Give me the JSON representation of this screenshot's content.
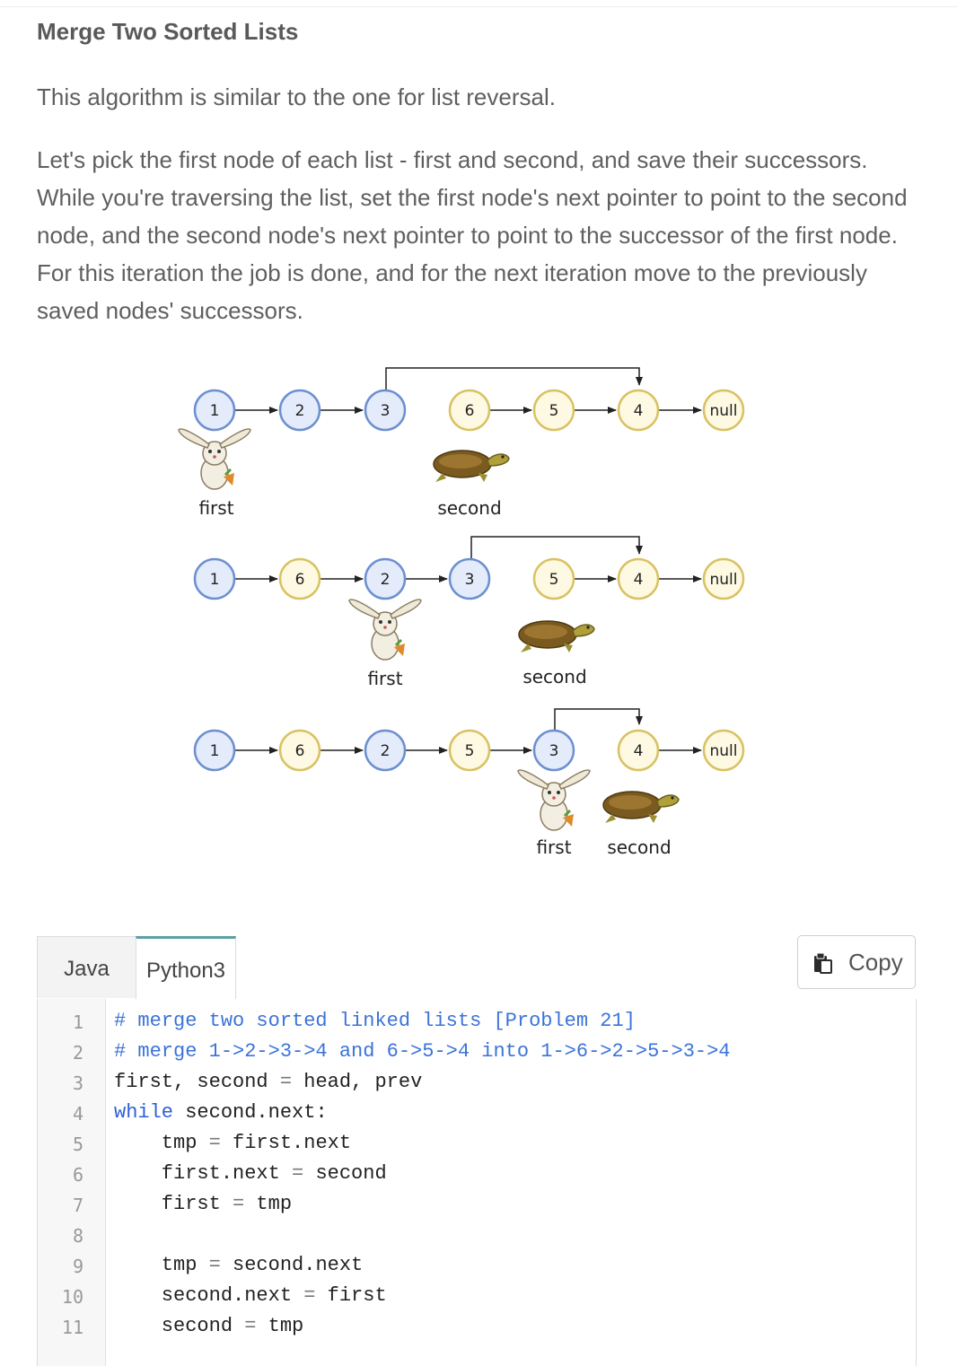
{
  "article": {
    "title": "Merge Two Sorted Lists",
    "paragraph1": "This algorithm is similar to the one for list reversal.",
    "paragraph2": "Let's pick the first node of each list - first and second, and save their successors. While you're traversing the list, set the first node's next pointer to point to the second node, and the second node's next pointer to point to the successor of the first node. For this iteration the job is done, and for the next iteration move to the previously saved nodes' successors."
  },
  "diagram": {
    "rows": [
      {
        "nodes": [
          {
            "text": "1",
            "color": "blue"
          },
          {
            "text": "2",
            "color": "blue"
          },
          {
            "text": "3",
            "color": "blue"
          },
          {
            "text": "6",
            "color": "yellow"
          },
          {
            "text": "5",
            "color": "yellow"
          },
          {
            "text": "4",
            "color": "yellow"
          },
          {
            "text": "null",
            "color": "yellow"
          }
        ],
        "labels": {
          "first": "first",
          "second": "second"
        }
      },
      {
        "nodes": [
          {
            "text": "1",
            "color": "blue"
          },
          {
            "text": "6",
            "color": "yellow"
          },
          {
            "text": "2",
            "color": "blue"
          },
          {
            "text": "3",
            "color": "blue"
          },
          {
            "text": "5",
            "color": "yellow"
          },
          {
            "text": "4",
            "color": "yellow"
          },
          {
            "text": "null",
            "color": "yellow"
          }
        ],
        "labels": {
          "first": "first",
          "second": "second"
        }
      },
      {
        "nodes": [
          {
            "text": "1",
            "color": "blue"
          },
          {
            "text": "6",
            "color": "yellow"
          },
          {
            "text": "2",
            "color": "blue"
          },
          {
            "text": "5",
            "color": "yellow"
          },
          {
            "text": "3",
            "color": "blue"
          },
          {
            "text": "4",
            "color": "yellow"
          },
          {
            "text": "null",
            "color": "yellow"
          }
        ],
        "labels": {
          "first": "first",
          "second": "second"
        }
      }
    ],
    "colors": {
      "blue_fill": "#e4ecfb",
      "blue_stroke": "#6d8fd1",
      "yellow_fill": "#fdf9e2",
      "yellow_stroke": "#d9c263"
    }
  },
  "code_block": {
    "tabs": [
      {
        "label": "Java",
        "active": false
      },
      {
        "label": "Python3",
        "active": true
      }
    ],
    "copy_label": "Copy",
    "line_numbers": [
      "1",
      "2",
      "3",
      "4",
      "5",
      "6",
      "7",
      "8",
      "9",
      "10",
      "11"
    ],
    "lines": {
      "l1": "# merge two sorted linked lists [Problem 21]",
      "l2": "# merge 1->2->3->4 and 6->5->4 into 1->6->2->5->3->4",
      "l3a": "first, second ",
      "l3op": "=",
      "l3b": " head, prev",
      "l4kw": "while",
      "l4b": " second.next:",
      "l5a": "    tmp ",
      "l5op": "=",
      "l5b": " first.next",
      "l6a": "    first.next ",
      "l6op": "=",
      "l6b": " second",
      "l7a": "    first ",
      "l7op": "=",
      "l7b": " tmp",
      "l9a": "    tmp ",
      "l9op": "=",
      "l9b": " second.next",
      "l10a": "    second.next ",
      "l10op": "=",
      "l10b": " first",
      "l11a": "    second ",
      "l11op": "=",
      "l11b": " tmp"
    }
  }
}
